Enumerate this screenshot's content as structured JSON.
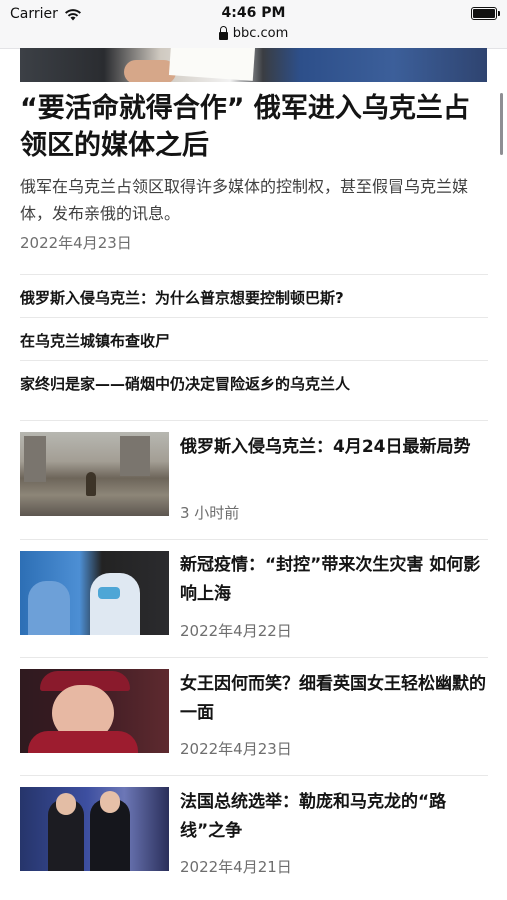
{
  "status_bar": {
    "carrier": "Carrier",
    "time": "4:46 PM",
    "url": "bbc.com"
  },
  "hero": {
    "headline": "“要活命就得合作” 俄军进入乌克兰占领区的媒体之后",
    "summary": "俄军在乌克兰占领区取得许多媒体的控制权，甚至假冒乌克兰媒体，发布亲俄的讯息。",
    "date": "2022年4月23日"
  },
  "related_links": [
    {
      "label": "俄罗斯入侵乌克兰：为什么普京想要控制顿巴斯?"
    },
    {
      "label": "在乌克兰城镇布查收尸"
    },
    {
      "label": "家终归是家——硝烟中仍决定冒险返乡的乌克兰人"
    }
  ],
  "cards": [
    {
      "title": "俄罗斯入侵乌克兰：4月24日最新局势",
      "date": "3 小时前"
    },
    {
      "title": "新冠疫情：“封控”带来次生灾害 如何影响上海",
      "date": "2022年4月22日"
    },
    {
      "title": "女王因何而笑？细看英国女王轻松幽默的一面",
      "date": "2022年4月23日"
    },
    {
      "title": "法国总统选举：勒庞和马克龙的“路线”之争",
      "date": "2022年4月21日"
    }
  ]
}
